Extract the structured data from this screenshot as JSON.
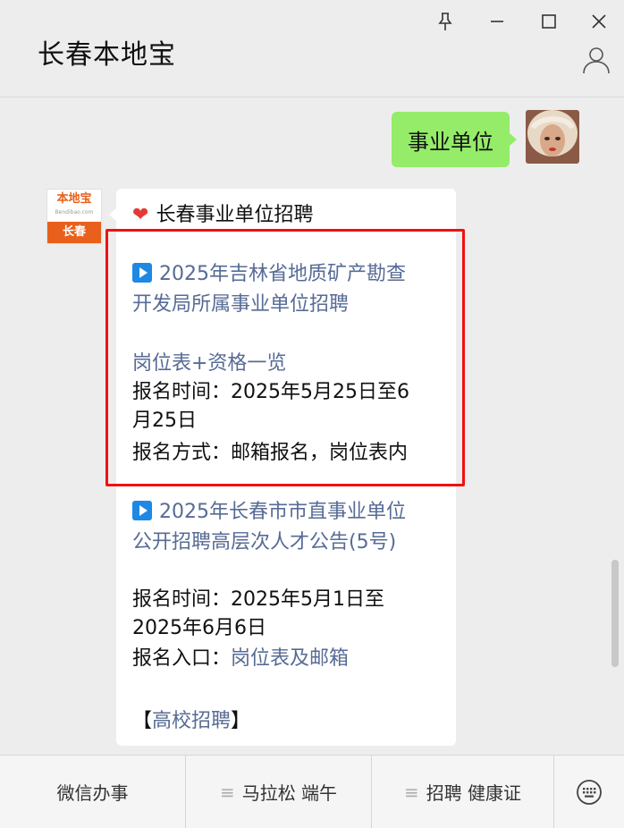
{
  "window": {
    "title": "长春本地宝",
    "pin_icon": "pin-icon",
    "min_icon": "minimize-icon",
    "max_icon": "maximize-icon",
    "close_icon": "close-icon",
    "profile_icon": "person-icon"
  },
  "chat": {
    "outgoing_message": "事业单位",
    "bot": {
      "avatar_brand": "本地宝",
      "avatar_sub": "Bendibao.com",
      "avatar_city": "长春"
    },
    "incoming": {
      "header_icon": "heart-icon",
      "header": "长春事业单位招聘",
      "item1_title_line1": "2025年吉林省地质矿产勘查",
      "item1_title_line2": "开发局所属事业单位招聘",
      "item1_link": "岗位表+资格一览",
      "item1_time_line1": "报名时间：2025年5月25日至6",
      "item1_time_line2": "月25日",
      "item1_method": "报名方式：邮箱报名，岗位表内",
      "item2_title_line1": "2025年长春市市直事业单位",
      "item2_title_line2": "公开招聘高层次人才公告(5号)",
      "item2_time_line1": "报名时间：2025年5月1日至",
      "item2_time_line2": "2025年6月6日",
      "item2_entry_label": "报名入口：",
      "item2_entry_link": "岗位表及邮箱",
      "section_open": "【",
      "section_link": "高校招聘",
      "section_close": "】"
    }
  },
  "bottom_menu": {
    "items": [
      "微信办事",
      "马拉松 端午",
      "招聘 健康证"
    ],
    "keyboard_icon": "keyboard-icon"
  },
  "colors": {
    "bg": "#ededed",
    "outgoing": "#95ec69",
    "link": "#576b95",
    "highlight": "#ee1111",
    "brand": "#e8601c"
  }
}
